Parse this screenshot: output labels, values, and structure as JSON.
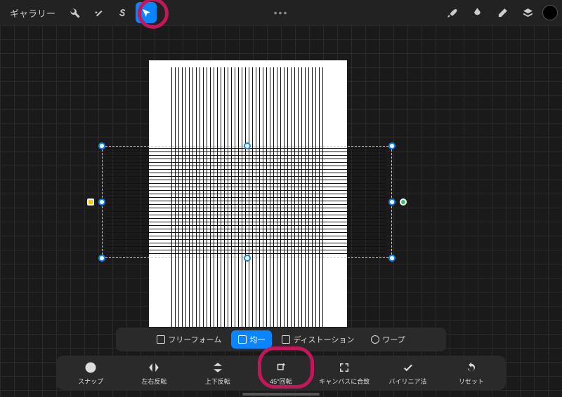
{
  "topbar": {
    "gallery": "ギャラリー",
    "ellipsis": "•••"
  },
  "modes": {
    "freeform": "フリーフォーム",
    "uniform": "均一",
    "distort": "ディストーション",
    "warp": "ワープ"
  },
  "actions": {
    "snap": "スナップ",
    "flip_h": "左右反転",
    "flip_v": "上下反転",
    "rotate45": "45°回転",
    "fit_canvas": "キャンバスに合致",
    "bilinear": "バイリニア法",
    "reset": "リセット"
  }
}
